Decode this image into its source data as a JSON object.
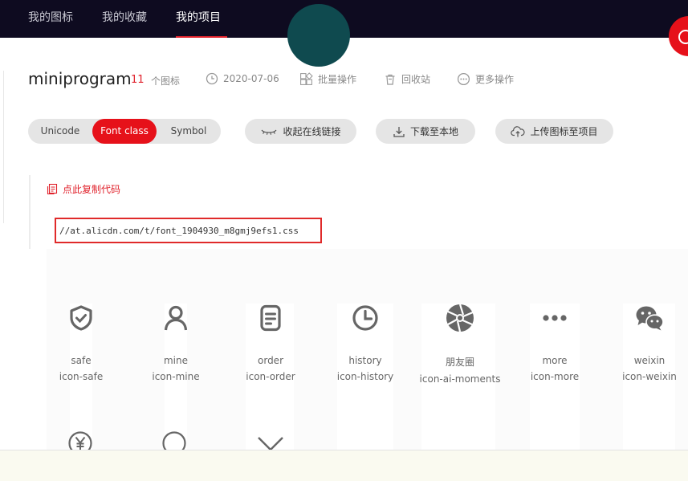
{
  "nav": {
    "tabs": [
      {
        "label": "我的图标"
      },
      {
        "label": "我的收藏"
      },
      {
        "label": "我的项目",
        "active": true
      }
    ]
  },
  "project": {
    "name": "miniprogram",
    "icon_count": "11",
    "icon_count_label": "个图标",
    "date": "2020-07-06",
    "batch_label": "批量操作",
    "recycle_label": "回收站",
    "more_label": "更多操作"
  },
  "toolbar": {
    "segments": [
      {
        "label": "Unicode",
        "active": false
      },
      {
        "label": "Font class",
        "active": true
      },
      {
        "label": "Symbol",
        "active": false
      }
    ],
    "collapse_label": "收起在线链接",
    "download_label": "下载至本地",
    "upload_label": "上传图标至项目"
  },
  "code": {
    "copy_label": "点此复制代码",
    "url": "//at.alicdn.com/t/font_1904930_m8gmj9efs1.css"
  },
  "icons": [
    {
      "name": "safe",
      "class_name": "icon-safe",
      "icon": "shield-check-icon"
    },
    {
      "name": "mine",
      "class_name": "icon-mine",
      "icon": "user-icon"
    },
    {
      "name": "order",
      "class_name": "icon-order",
      "icon": "document-icon"
    },
    {
      "name": "history",
      "class_name": "icon-history",
      "icon": "clock-icon"
    },
    {
      "name": "朋友圈",
      "class_name": "icon-ai-moments",
      "icon": "aperture-icon"
    },
    {
      "name": "more",
      "class_name": "icon-more",
      "icon": "more-dots-icon"
    },
    {
      "name": "weixin",
      "class_name": "icon-weixin",
      "icon": "wechat-icon"
    }
  ],
  "icons_row2": [
    {
      "icon": "yen-circle-icon"
    },
    {
      "icon": "circle-icon"
    },
    {
      "icon": "chevron-down-icon"
    }
  ],
  "colors": {
    "accent": "#e6111a",
    "nav_bg": "#0e0b20",
    "icon_gray": "#666666"
  }
}
